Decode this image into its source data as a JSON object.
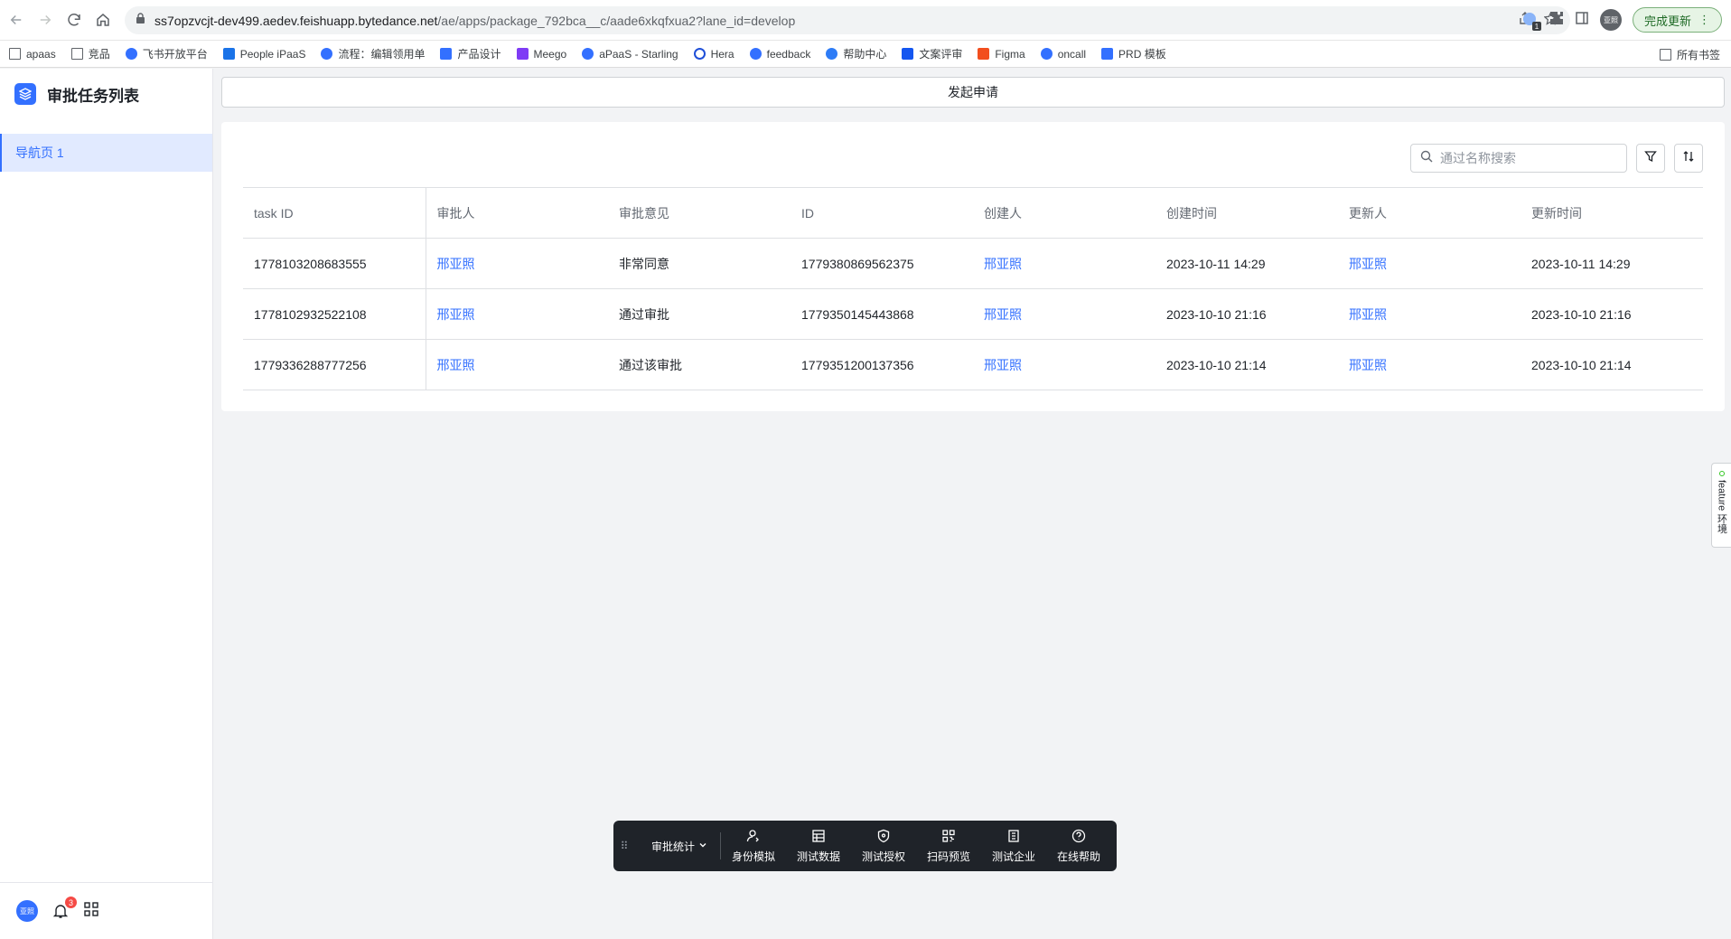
{
  "browser": {
    "url_host": "ss7opzvcjt-dev499.aedev.feishuapp.bytedance.net",
    "url_path": "/ae/apps/package_792bca__c/aade6xkqfxua2?lane_id=develop",
    "update_button": "完成更新",
    "ext_badge": "1",
    "profile_initials": "亚照",
    "bookmarks": [
      "apaas",
      "竞品",
      "飞书开放平台",
      "People iPaaS",
      "流程：编辑领用单",
      "产品设计",
      "Meego",
      "aPaaS - Starling",
      "Hera",
      "feedback",
      "帮助中心",
      "文案评审",
      "Figma",
      "oncall",
      "PRD 模板"
    ],
    "all_bookmarks": "所有书签"
  },
  "app": {
    "title": "审批任务列表",
    "nav": [
      "导航页 1"
    ],
    "avatar_initials": "亚照",
    "notification_count": "3"
  },
  "main": {
    "launch_label": "发起申请",
    "search_placeholder": "通过名称搜索",
    "columns": [
      "task ID",
      "审批人",
      "审批意见",
      "ID",
      "创建人",
      "创建时间",
      "更新人",
      "更新时间"
    ],
    "rows": [
      [
        "1778103208683555",
        "邢亚照",
        "非常同意",
        "1779380869562375",
        "邢亚照",
        "2023-10-11 14:29",
        "邢亚照",
        "2023-10-11 14:29"
      ],
      [
        "1778102932522108",
        "邢亚照",
        "通过审批",
        "1779350145443868",
        "邢亚照",
        "2023-10-10 21:16",
        "邢亚照",
        "2023-10-10 21:16"
      ],
      [
        "1779336288777256",
        "邢亚照",
        "通过该审批",
        "1779351200137356",
        "邢亚照",
        "2023-10-10 21:14",
        "邢亚照",
        "2023-10-10 21:14"
      ]
    ]
  },
  "feature_tab": "feature 环境",
  "devbar": {
    "dropdown": "审批统计",
    "items": [
      {
        "label": "身份模拟",
        "icon": "user-switch-icon"
      },
      {
        "label": "测试数据",
        "icon": "table-icon"
      },
      {
        "label": "测试授权",
        "icon": "shield-icon"
      },
      {
        "label": "扫码预览",
        "icon": "qrcode-icon"
      },
      {
        "label": "测试企业",
        "icon": "building-icon"
      },
      {
        "label": "在线帮助",
        "icon": "help-icon"
      }
    ]
  },
  "colors": {
    "accent": "#3370ff",
    "nav_active_bg": "#e1eaff",
    "devbar_bg": "#1f2329",
    "page_bg": "#f2f3f5"
  }
}
